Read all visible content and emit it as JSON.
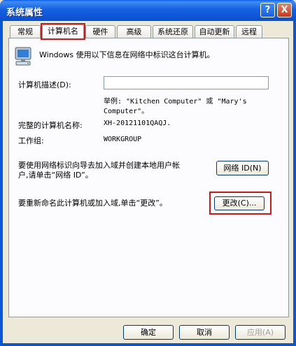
{
  "window": {
    "title": "系统属性"
  },
  "title_buttons": {
    "help": "?",
    "close": "X"
  },
  "tabs": [
    {
      "label": "常规",
      "active": false
    },
    {
      "label": "计算机名",
      "active": true
    },
    {
      "label": "硬件",
      "active": false
    },
    {
      "label": "高级",
      "active": false
    },
    {
      "label": "系统还原",
      "active": false
    },
    {
      "label": "自动更新",
      "active": false
    },
    {
      "label": "远程",
      "active": false
    }
  ],
  "computer_name": {
    "intro": "Windows 使用以下信息在网络中标识这台计算机。",
    "description_label": "计算机描述(D):",
    "description_value": "",
    "example_line1": "举例: \"Kitchen Computer\" 或 \"Mary's",
    "example_line2": "Computer\"。",
    "full_name_label": "完整的计算机名称:",
    "full_name_value": "XH-20121101QAQJ.",
    "workgroup_label": "工作组:",
    "workgroup_value": "WORKGROUP",
    "network_id_text_line1": "要使用网络标识向导去加入域并创建本地用户帐",
    "network_id_text_line2": "户,请单击“网络 ID”。",
    "network_id_button": "网络 ID(N)",
    "rename_text": "要重新命名此计算机或加入域,单击“更改”。",
    "change_button": "更改(C)..."
  },
  "footer": {
    "ok_button": "确定",
    "cancel_button": "取消",
    "apply_button": "应用(A)"
  },
  "colors": {
    "titlebar": "#0a4fd0",
    "highlight_box": "#d01818",
    "dialog_bg": "#ece9d8",
    "active_tab_accent": "#e68b2c"
  }
}
